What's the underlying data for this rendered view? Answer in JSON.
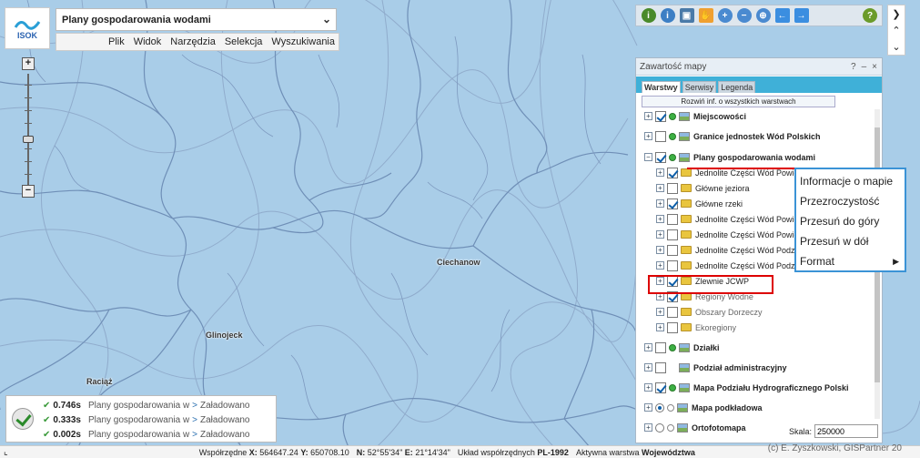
{
  "app": {
    "logo_text": "ISOK",
    "title": "Plany gospodarowania wodami"
  },
  "menu": [
    "Plik",
    "Widok",
    "Narzędzia",
    "Selekcja",
    "Wyszukiwania"
  ],
  "map": {
    "cities": [
      "Ciechanow",
      "Glinojeck",
      "Raciąż"
    ]
  },
  "panel": {
    "title": "Zawartość mapy",
    "controls": [
      "?",
      "–",
      "×"
    ],
    "tabs": [
      "Warstwy",
      "Serwisy",
      "Legenda"
    ],
    "expand_all_label": "Rozwiń inf. o wszystkich warstwach",
    "layers": [
      {
        "name": "Miejscowości",
        "level": 0,
        "checked": true,
        "kind": "dot",
        "bold": true
      },
      {
        "name": "Granice jednostek Wód Polskich",
        "level": 0,
        "checked": false,
        "kind": "dot",
        "bold": true
      },
      {
        "name": "Plany gospodarowania wodami",
        "level": 0,
        "checked": true,
        "kind": "dot",
        "bold": true,
        "expanded": true
      },
      {
        "name": "Jednolite Części Wód Powierzchniowych",
        "level": 1,
        "checked": true
      },
      {
        "name": "Główne jeziora",
        "level": 1,
        "checked": false
      },
      {
        "name": "Główne rzeki",
        "level": 1,
        "checked": true
      },
      {
        "name": "Jednolite Części Wód Powierzchniowych",
        "level": 1,
        "checked": false
      },
      {
        "name": "Jednolite Części Wód Powierzchniowych",
        "level": 1,
        "checked": false
      },
      {
        "name": "Jednolite Części Wód Podziemnych",
        "level": 1,
        "checked": false
      },
      {
        "name": "Jednolite Części Wód Podziemnych",
        "level": 1,
        "checked": false
      },
      {
        "name": "Zlewnie JCWP",
        "level": 1,
        "checked": true
      },
      {
        "name": "Regiony Wodne",
        "level": 1,
        "checked": true,
        "grey": true
      },
      {
        "name": "Obszary Dorzeczy",
        "level": 1,
        "checked": false,
        "grey": true
      },
      {
        "name": "Ekoregiony",
        "level": 1,
        "checked": false,
        "grey": true
      },
      {
        "name": "Działki",
        "level": 0,
        "checked": false,
        "kind": "dot",
        "bold": true
      },
      {
        "name": "Podział administracyjny",
        "level": 0,
        "checked": false,
        "kind": "none",
        "bold": true
      },
      {
        "name": "Mapa Podziału Hydrograficznego Polski",
        "level": 0,
        "checked": true,
        "kind": "dot",
        "bold": true
      },
      {
        "name": "Mapa podkładowa",
        "level": 0,
        "checked": true,
        "kind": "radio",
        "bold": true
      },
      {
        "name": "Ortofotomapa",
        "level": 0,
        "checked": false,
        "kind": "radio",
        "bold": true
      }
    ],
    "scale_label": "Skala:",
    "scale_value": "250000"
  },
  "context_menu": {
    "items": [
      "Informacje o mapie",
      "Przezroczystość",
      "Przesuń do góry",
      "Przesuń w dół",
      "Format"
    ]
  },
  "status": {
    "rows": [
      {
        "time": "0.746s",
        "name": "Plany gospodarowania w",
        "result": "Załadowano"
      },
      {
        "time": "0.333s",
        "name": "Plany gospodarowania w",
        "result": "Załadowano"
      },
      {
        "time": "0.002s",
        "name": "Plany gospodarowania w",
        "result": "Załadowano"
      }
    ]
  },
  "footer": {
    "coords_label": "Współrzędne",
    "x_label": "X:",
    "x_value": "564647.24",
    "y_label": "Y:",
    "y_value": "650708.10",
    "n_label": "N:",
    "n_value": "52°55'34\"",
    "e_label": "E:",
    "e_value": "21°14'34\"",
    "crs_label": "Układ współrzędnych",
    "crs_value": "PL-1992",
    "active_label": "Aktywna warstwa",
    "active_value": "Województwa",
    "copyright": "(c) E. Zyszkowski, GISPartner 20"
  },
  "colors": {
    "map_background": "#a9cde8",
    "river": "#6f8fb7",
    "basin": "#8aa4c6",
    "accent": "#3fb0d8",
    "highlight": "#dd0000"
  }
}
